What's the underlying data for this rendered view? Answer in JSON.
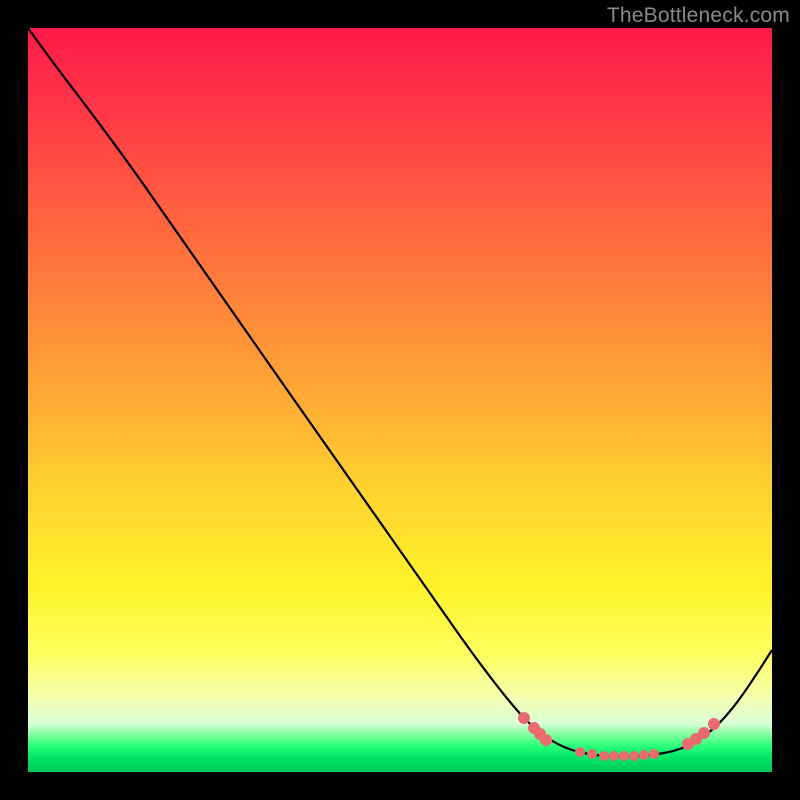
{
  "watermark": "TheBottleneck.com",
  "colors": {
    "dot": "#e96a6f",
    "line": "#000000",
    "frame": "#000000"
  },
  "chart_data": {
    "type": "line",
    "title": "",
    "xlabel": "",
    "ylabel": "",
    "xlim": [
      0,
      100
    ],
    "ylim": [
      0,
      100
    ],
    "grid": false,
    "legend": false,
    "series": [
      {
        "name": "bottleneck-curve",
        "x": [
          0,
          4,
          8,
          12,
          18,
          26,
          34,
          42,
          50,
          58,
          64,
          68,
          72,
          76,
          80,
          84,
          88,
          92,
          96,
          100
        ],
        "y": [
          100,
          96,
          92,
          87,
          79,
          68,
          57,
          46,
          35,
          24,
          15,
          10,
          6,
          3.5,
          3,
          3,
          4,
          8,
          15,
          23
        ]
      }
    ],
    "highlight_points": {
      "name": "marked-dots",
      "x": [
        66,
        68,
        69,
        74,
        76,
        78,
        79,
        80,
        81,
        82,
        83,
        88,
        89,
        90,
        92
      ],
      "y": [
        12,
        9,
        8,
        4,
        3.5,
        3.2,
        3.2,
        3.1,
        3.1,
        3.2,
        3.3,
        5,
        6,
        7,
        10
      ]
    }
  }
}
